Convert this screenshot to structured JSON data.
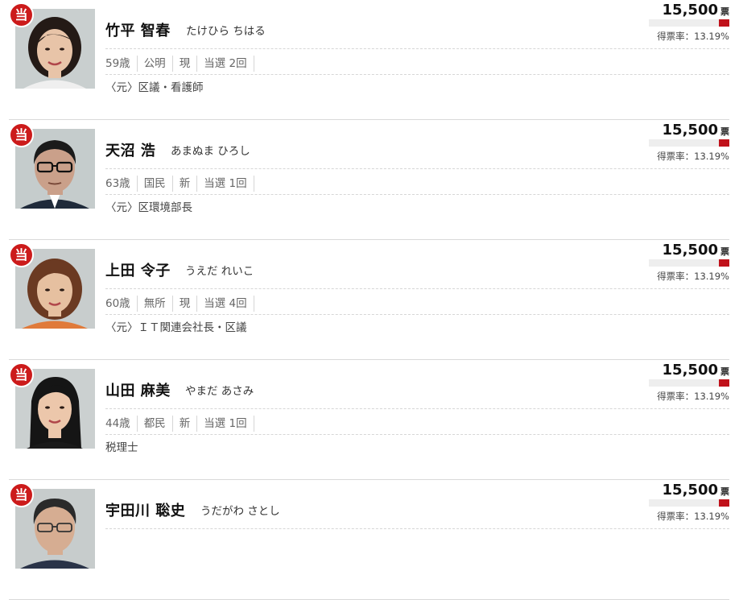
{
  "candidates": [
    {
      "elected_mark": "当",
      "name": "竹平 智春",
      "kana": "たけひら ちはる",
      "age": "59歳",
      "party": "公明",
      "status": "現",
      "wins": "当選 2回",
      "career": "〈元〉区議・看護師",
      "votes": "15,500",
      "votes_unit": "票",
      "rate": "得票率：13.19%",
      "rate_value": 13.19,
      "photo": "woman-short-hair",
      "bg": "#c9cfcf",
      "skin": "#e8c4a8",
      "hair": "#241a16",
      "cloth": "#efefef"
    },
    {
      "elected_mark": "当",
      "name": "天沼 浩",
      "kana": "あまぬま ひろし",
      "age": "63歳",
      "party": "国民",
      "status": "新",
      "wins": "当選 1回",
      "career": "〈元〉区環境部長",
      "votes": "15,500",
      "votes_unit": "票",
      "rate": "得票率：13.19%",
      "rate_value": 13.19,
      "photo": "man-glasses",
      "bg": "#c5cccc",
      "skin": "#caa08a",
      "hair": "#1b1b1b",
      "cloth": "#1f2a3a"
    },
    {
      "elected_mark": "当",
      "name": "上田 令子",
      "kana": "うえだ れいこ",
      "age": "60歳",
      "party": "無所",
      "status": "現",
      "wins": "当選 4回",
      "career": "〈元〉ＩＴ関連会社長・区議",
      "votes": "15,500",
      "votes_unit": "票",
      "rate": "得票率：13.19%",
      "rate_value": 13.19,
      "photo": "woman-bob",
      "bg": "#c8cdcd",
      "skin": "#e6c0a0",
      "hair": "#6b3a22",
      "cloth": "#e07a3a"
    },
    {
      "elected_mark": "当",
      "name": "山田 麻美",
      "kana": "やまだ あさみ",
      "age": "44歳",
      "party": "都民",
      "status": "新",
      "wins": "当選 1回",
      "career": "税理士",
      "votes": "15,500",
      "votes_unit": "票",
      "rate": "得票率：13.19%",
      "rate_value": 13.19,
      "photo": "woman-long-hair",
      "bg": "#cbd0d0",
      "skin": "#ecc7ab",
      "hair": "#151515",
      "cloth": "#1a1a1a"
    },
    {
      "elected_mark": "当",
      "name": "宇田川 聡史",
      "kana": "うだがわ さとし",
      "age": "",
      "party": "",
      "status": "",
      "wins": "",
      "career": "",
      "votes": "15,500",
      "votes_unit": "票",
      "rate": "得票率：13.19%",
      "rate_value": 13.19,
      "photo": "man-glasses-2",
      "bg": "#c7cccc",
      "skin": "#d6ad92",
      "hair": "#2a2a2a",
      "cloth": "#2a3348"
    }
  ]
}
